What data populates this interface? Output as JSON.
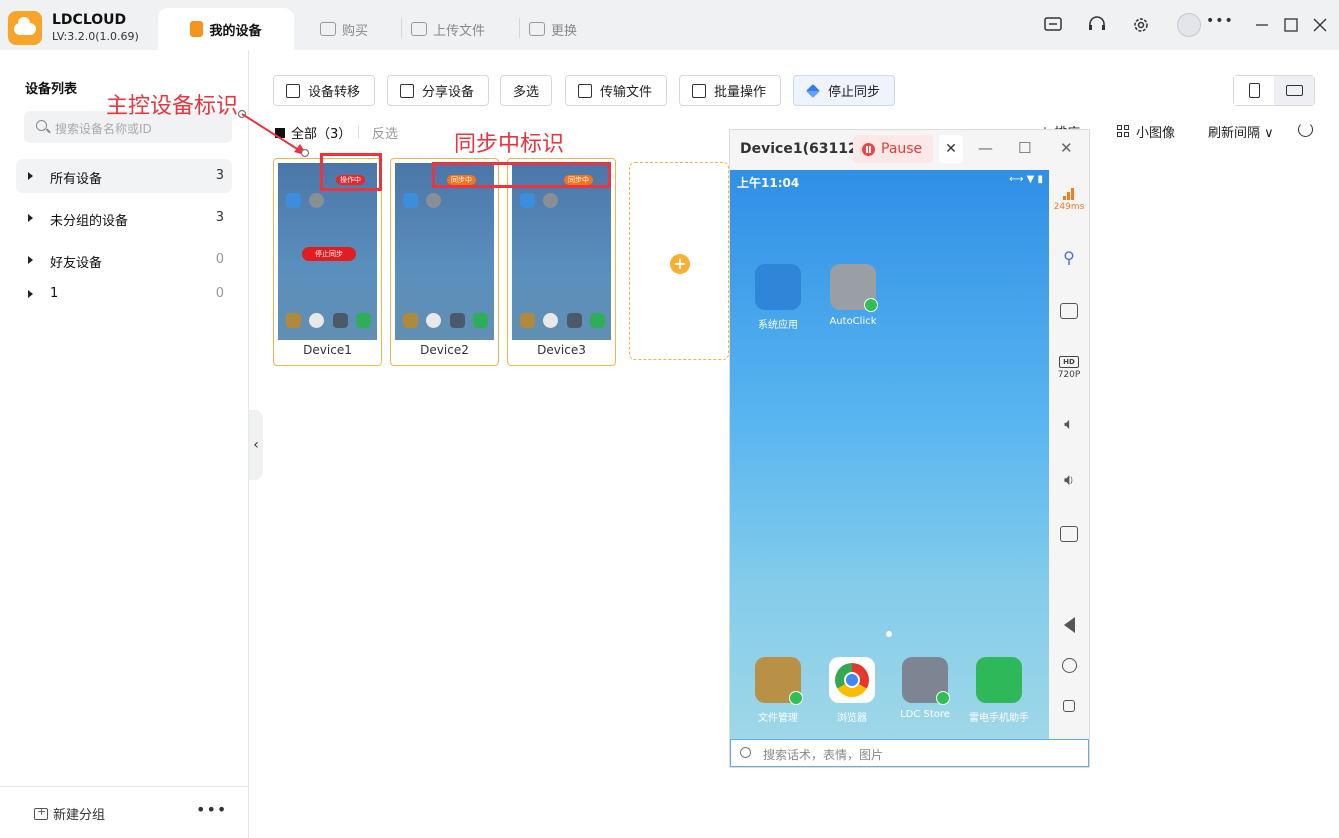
{
  "app": {
    "name": "LDCLOUD",
    "version": "LV:3.2.0(1.0.69)"
  },
  "tabs": [
    {
      "label": "我的设备",
      "active": true
    },
    {
      "label": "购买"
    },
    {
      "label": "上传文件"
    },
    {
      "label": "更换"
    }
  ],
  "window_controls": {
    "more": "•••"
  },
  "sidebar": {
    "title": "设备列表",
    "search_placeholder": "搜索设备名称或ID",
    "groups": [
      {
        "name": "所有设备",
        "count": "3"
      },
      {
        "name": "未分组的设备",
        "count": "3"
      },
      {
        "name": "好友设备",
        "count": "0"
      },
      {
        "name": "1",
        "count": "0"
      }
    ],
    "new_group": "新建分组",
    "more": "•••"
  },
  "toolbar": {
    "transfer": "设备转移",
    "share": "分享设备",
    "multi": "多选",
    "file": "传输文件",
    "batch": "批量操作",
    "stop_sync": "停止同步"
  },
  "list": {
    "select_all": "全部（3）",
    "inverse": "反选",
    "sort": "排序",
    "thumb": "小图像",
    "interval": "刷新间隔 ∨"
  },
  "devices": [
    {
      "name": "Device1",
      "badge": "操作中",
      "stop": "停止同步"
    },
    {
      "name": "Device2",
      "badge": "同步中"
    },
    {
      "name": "Device3",
      "badge": "同步中"
    }
  ],
  "annotations": {
    "master": "主控设备标识",
    "sync": "同步中标识"
  },
  "device_window": {
    "title": "Device1(63112...",
    "pause": "Pause",
    "time": "上午11:04",
    "apps": [
      "系统应用",
      "AutoClick"
    ],
    "dock": [
      "文件管理",
      "浏览器",
      "LDC Store",
      "雷电手机助手"
    ],
    "input_placeholder": "搜索话术，表情，图片",
    "latency": "249ms",
    "quality": "720P",
    "hd": "HD"
  },
  "colors": {
    "accent": "#f7941e",
    "annotation": "#e8353f",
    "sync": "#f5731c",
    "control": "#e7272b"
  }
}
